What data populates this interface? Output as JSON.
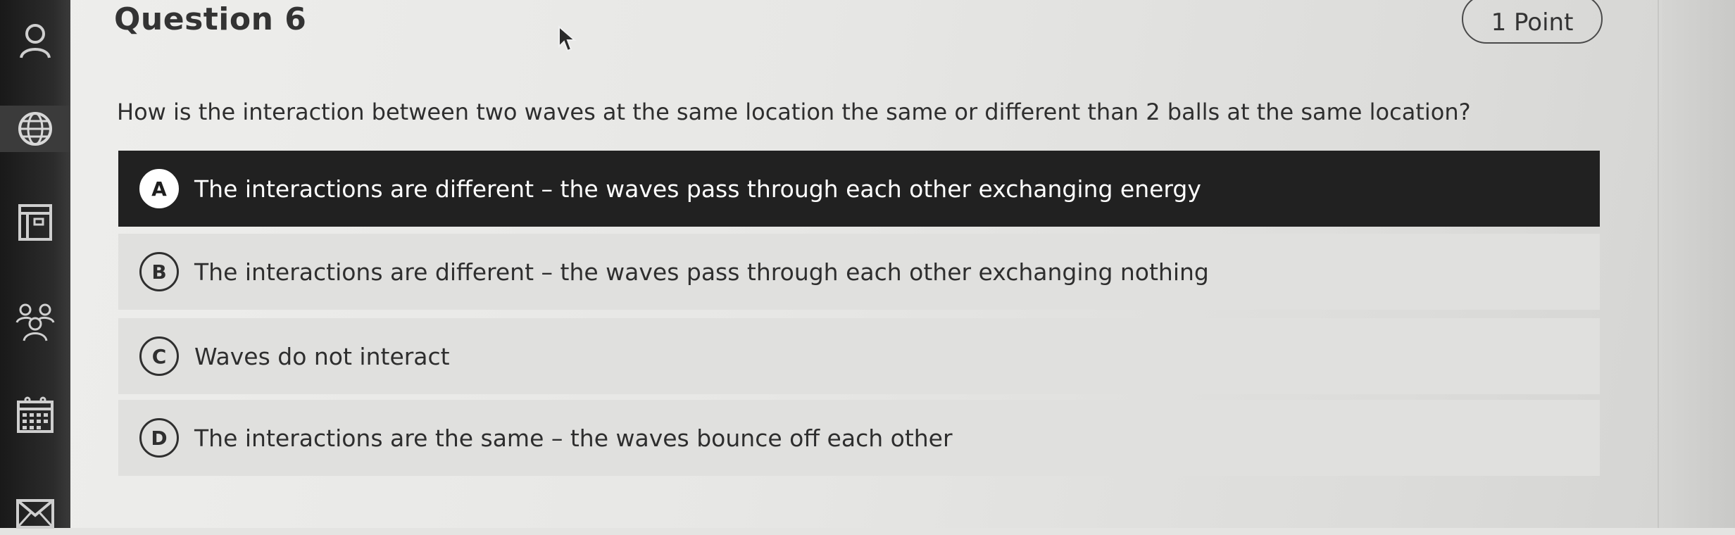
{
  "sidebar": {
    "items": [
      {
        "icon": "user-icon"
      },
      {
        "icon": "globe-icon"
      },
      {
        "icon": "layout-icon"
      },
      {
        "icon": "group-icon"
      },
      {
        "icon": "calendar-icon"
      },
      {
        "icon": "mail-icon"
      }
    ]
  },
  "question": {
    "title": "Question 6",
    "points": "1 Point",
    "text": "How is the interaction between two waves at the same location the same or different than 2 balls at the same location?"
  },
  "options": [
    {
      "letter": "A",
      "text": "The interactions are different – the waves pass through each other exchanging energy",
      "selected": true
    },
    {
      "letter": "B",
      "text": "The interactions are different – the waves pass through each other exchanging nothing",
      "selected": false
    },
    {
      "letter": "C",
      "text": "Waves do not interact",
      "selected": false
    },
    {
      "letter": "D",
      "text": "The interactions are the same – the waves bounce off each other",
      "selected": false
    }
  ],
  "colors": {
    "selected_background": "#212121",
    "option_background": "#e0e0de",
    "text": "#2e2e2e",
    "sidebar": "#1f1f1f"
  }
}
